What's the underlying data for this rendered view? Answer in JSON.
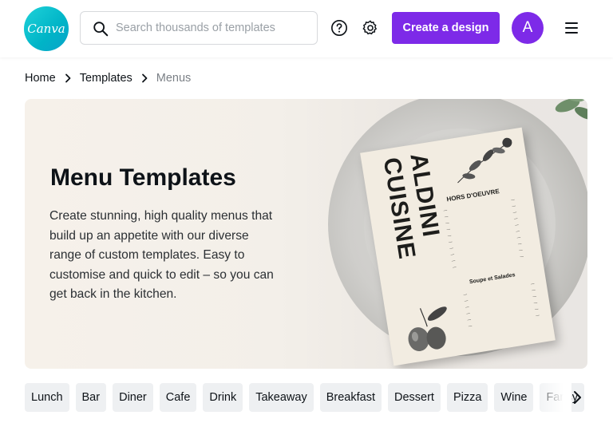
{
  "header": {
    "logo_text": "Canva",
    "search": {
      "placeholder": "Search thousands of templates",
      "value": ""
    },
    "create_label": "Create a design",
    "avatar_initial": "A",
    "icons": [
      "search-icon",
      "help-icon",
      "gear-icon",
      "hamburger-menu-icon"
    ]
  },
  "breadcrumb": {
    "items": [
      {
        "label": "Home"
      },
      {
        "label": "Templates"
      },
      {
        "label": "Menus"
      }
    ]
  },
  "hero": {
    "title": "Menu Templates",
    "description": "Create stunning, high quality menus that build up an appetite with our diverse range of custom templates. Easy to customise and quick to edit – so you can get back in the kitchen.",
    "menu_preview": {
      "brand_line1": "ALDINI",
      "brand_line2": "CUISINE",
      "section1": "HORS D'OEUVRE",
      "section2": "Soupe et Salades"
    }
  },
  "categories": [
    "Lunch",
    "Bar",
    "Diner",
    "Cafe",
    "Drink",
    "Takeaway",
    "Breakfast",
    "Dessert",
    "Pizza",
    "Wine",
    "Fancy"
  ],
  "colors": {
    "brand_teal": "#00c4cc",
    "accent_purple": "#7d2ae8",
    "chip_bg": "#eef0f2"
  }
}
